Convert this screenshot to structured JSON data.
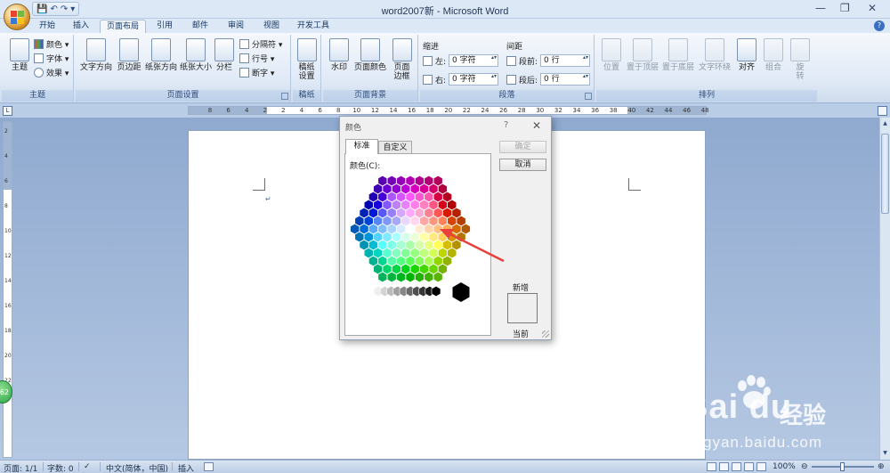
{
  "window": {
    "title": "word2007新 - Microsoft Word",
    "controls": [
      "—",
      "❐",
      "✕"
    ]
  },
  "qat": {
    "items": [
      "💾",
      "↶",
      "↷",
      "▾"
    ]
  },
  "tabs": [
    "开始",
    "插入",
    "页面布局",
    "引用",
    "邮件",
    "审阅",
    "视图",
    "开发工具"
  ],
  "active_tab": "页面布局",
  "ribbon": {
    "theme": {
      "label": "主题",
      "big": "主题",
      "items": [
        "颜色 ▾",
        "字体 ▾",
        "效果 ▾"
      ]
    },
    "page_setup": {
      "label": "页面设置",
      "buttons": [
        "文字方向",
        "页边距",
        "纸张方向",
        "纸张大小",
        "分栏"
      ],
      "small": [
        "分隔符 ▾",
        "行号 ▾",
        "断字 ▾"
      ]
    },
    "manuscript": {
      "label": "稿纸",
      "buttons": [
        "稿纸",
        "设置"
      ]
    },
    "page_background": {
      "label": "页面背景",
      "buttons": [
        "水印",
        "页面颜色",
        "页面",
        "边框"
      ]
    },
    "paragraph": {
      "label": "段落",
      "indent_title": "缩进",
      "spacing_title": "间距",
      "left_label": "左:",
      "right_label": "右:",
      "before_label": "段前:",
      "after_label": "段后:",
      "left_value": "0 字符",
      "right_value": "0 字符",
      "before_value": "0 行",
      "after_value": "0 行"
    },
    "arrange": {
      "label": "排列",
      "buttons": [
        "位置",
        "置于顶层",
        "置于底层",
        "文字环绕",
        "对齐",
        "组合",
        "旋",
        "转"
      ]
    }
  },
  "ruler_ticks": [
    "8",
    "6",
    "4",
    "2",
    "2",
    "4",
    "6",
    "8",
    "10",
    "12",
    "14",
    "16",
    "18",
    "20",
    "22",
    "24",
    "26",
    "28",
    "30",
    "32",
    "34",
    "36",
    "38",
    "40",
    "42",
    "44",
    "46",
    "48"
  ],
  "vruler_ticks": [
    "2",
    "4",
    "6",
    "8",
    "10",
    "12",
    "14",
    "16",
    "18",
    "20",
    "22"
  ],
  "badge": "62",
  "dialog": {
    "title": "颜色",
    "help": "?",
    "close": "✕",
    "tab_standard": "标准",
    "tab_custom": "自定义",
    "colors_label": "颜色(C):",
    "ok": "确定",
    "cancel": "取消",
    "new": "新增",
    "current": "当前"
  },
  "status": {
    "page": "页面: 1/1",
    "words": "字数: 0",
    "language": "中文(简体，中国)",
    "mode": "插入",
    "zoom": "100%",
    "zoom_minus": "⊖",
    "zoom_plus": "⊕"
  },
  "watermark": {
    "logo": "Bai du",
    "text": "经验",
    "url": "jingyan.baidu.com"
  }
}
